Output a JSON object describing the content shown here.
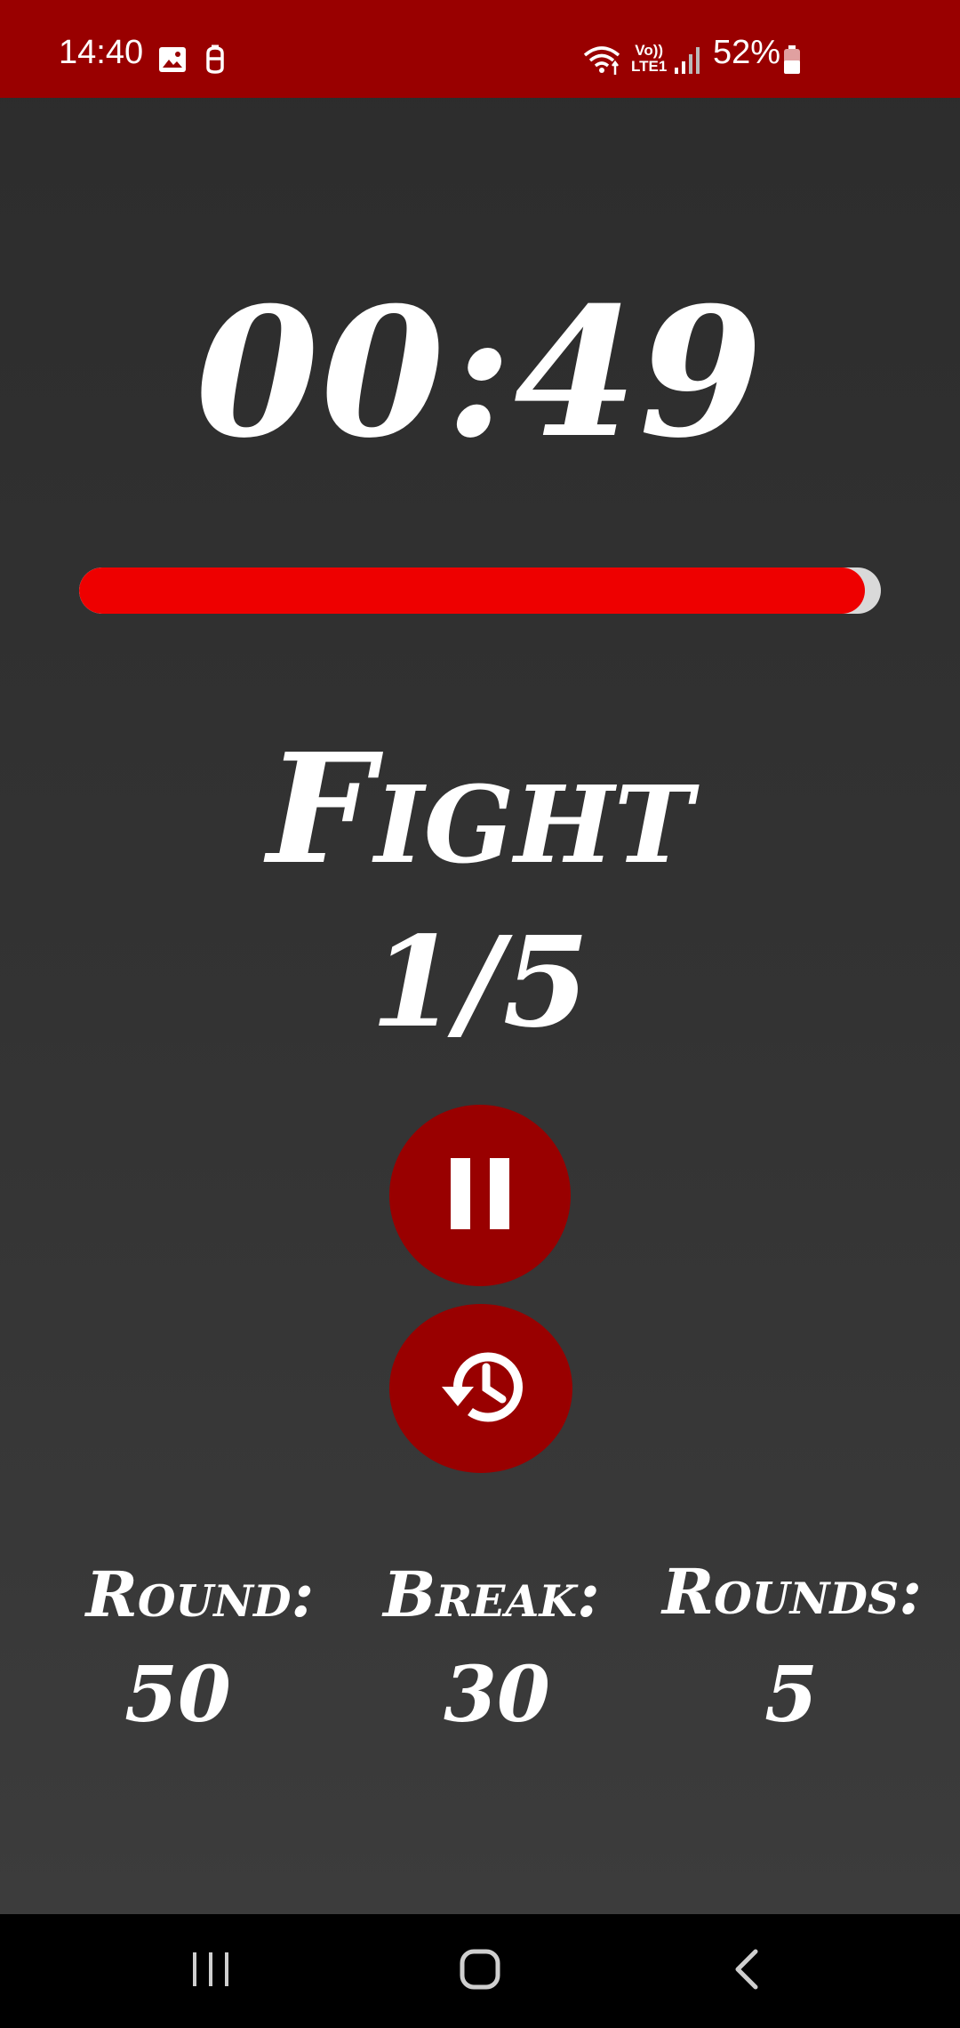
{
  "status_bar": {
    "time": "14:40",
    "network_label_top": "Vo))",
    "network_label_bottom": "LTE1",
    "battery": "52%",
    "icons": [
      "gallery-icon",
      "notification-icon",
      "wifi-icon",
      "signal-icon",
      "battery-icon"
    ]
  },
  "timer": {
    "value": "00:49",
    "progress_fraction": 0.98
  },
  "phase": {
    "label": "Fight",
    "round_progress": "1/5"
  },
  "controls": {
    "pause_icon": "pause-icon",
    "reset_icon": "history-icon"
  },
  "stats": [
    {
      "label": "Round:",
      "value": "50"
    },
    {
      "label": "Break:",
      "value": "30"
    },
    {
      "label": "Rounds:",
      "value": "5"
    }
  ],
  "nav_bar": {
    "icons": [
      "recents-icon",
      "home-icon",
      "back-icon"
    ]
  },
  "colors": {
    "accent": "#990000",
    "progress": "#ee0000",
    "background": "#2e2e2e"
  }
}
